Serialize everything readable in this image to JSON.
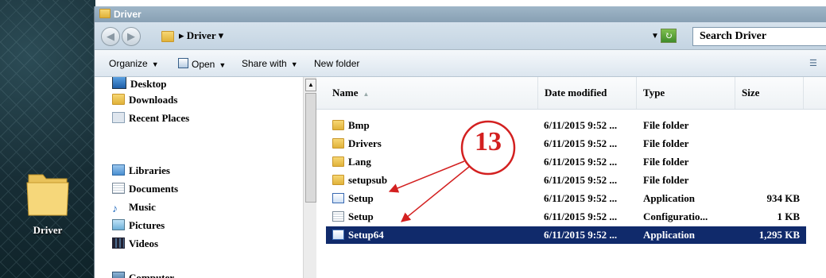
{
  "desktop": {
    "icon_label": "Driver"
  },
  "window": {
    "title": "Driver",
    "address": {
      "crumb": "Driver",
      "breadcrumb_text": "▸ Driver ▾"
    },
    "search_placeholder": "Search Driver"
  },
  "toolbar": {
    "organize": "Organize",
    "open": "Open",
    "share_with": "Share with",
    "new_folder": "New folder"
  },
  "nav": {
    "items": [
      {
        "label": "Desktop",
        "icon": "desktop-icon"
      },
      {
        "label": "Downloads",
        "icon": "downloads-icon"
      },
      {
        "label": "Recent Places",
        "icon": "recent-places-icon"
      },
      {
        "label": "Libraries",
        "icon": "libraries-icon"
      },
      {
        "label": "Documents",
        "icon": "documents-icon"
      },
      {
        "label": "Music",
        "icon": "music-icon"
      },
      {
        "label": "Pictures",
        "icon": "pictures-icon"
      },
      {
        "label": "Videos",
        "icon": "videos-icon"
      },
      {
        "label": "Computer",
        "icon": "computer-icon"
      }
    ]
  },
  "columns": {
    "name": "Name",
    "date": "Date modified",
    "type": "Type",
    "size": "Size"
  },
  "files": [
    {
      "name": "Bmp",
      "date": "6/11/2015 9:52 ...",
      "type": "File folder",
      "size": "",
      "icon": "folder-icon"
    },
    {
      "name": "Drivers",
      "date": "6/11/2015 9:52 ...",
      "type": "File folder",
      "size": "",
      "icon": "folder-icon"
    },
    {
      "name": "Lang",
      "date": "6/11/2015 9:52 ...",
      "type": "File folder",
      "size": "",
      "icon": "folder-icon"
    },
    {
      "name": "setupsub",
      "date": "6/11/2015 9:52 ...",
      "type": "File folder",
      "size": "",
      "icon": "folder-icon"
    },
    {
      "name": "Setup",
      "date": "6/11/2015 9:52 ...",
      "type": "Application",
      "size": "934 KB",
      "icon": "setup-app-icon"
    },
    {
      "name": "Setup",
      "date": "6/11/2015 9:52 ...",
      "type": "Configuratio...",
      "size": "1 KB",
      "icon": "config-file-icon"
    },
    {
      "name": "Setup64",
      "date": "6/11/2015 9:52 ...",
      "type": "Application",
      "size": "1,295 KB",
      "icon": "setup-app-icon",
      "selected": true
    }
  ],
  "annotation": {
    "number": "13",
    "color": "#d32020"
  },
  "colors": {
    "selection": "#102a6b",
    "desktop": "#172d35"
  }
}
